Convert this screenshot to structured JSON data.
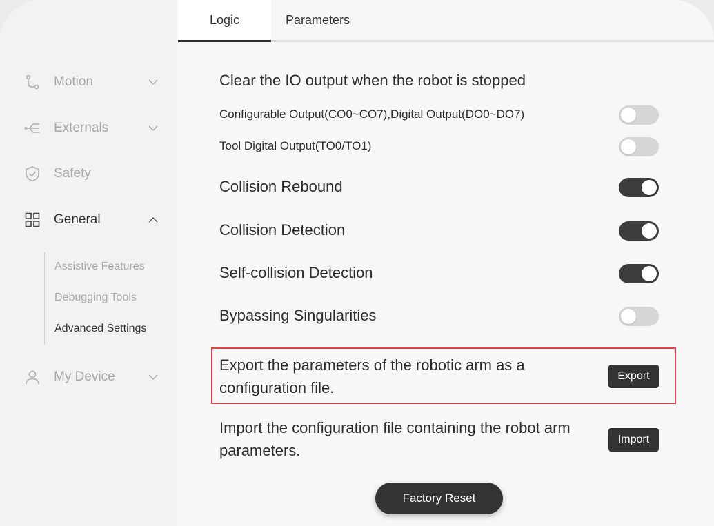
{
  "tabs": [
    {
      "label": "Logic",
      "active": true
    },
    {
      "label": "Parameters",
      "active": false
    }
  ],
  "sidebar": {
    "items": [
      {
        "label": "Motion",
        "icon": "route-icon",
        "expanded": false
      },
      {
        "label": "Externals",
        "icon": "branch-icon",
        "expanded": false
      },
      {
        "label": "Safety",
        "icon": "shield-check-icon"
      },
      {
        "label": "General",
        "icon": "grid-icon",
        "expanded": true
      },
      {
        "label": "My Device",
        "icon": "user-icon",
        "expanded": false
      }
    ],
    "general_subitems": [
      {
        "label": "Assistive Features",
        "current": false
      },
      {
        "label": "Debugging Tools",
        "current": false
      },
      {
        "label": "Advanced Settings",
        "current": true
      }
    ]
  },
  "settings": {
    "io_clear_heading": "Clear the IO output when the robot is stopped",
    "configurable_output": {
      "label": "Configurable Output(CO0~CO7),Digital Output(DO0~DO7)",
      "enabled": false
    },
    "tool_digital_output": {
      "label": "Tool Digital Output(TO0/TO1)",
      "enabled": false
    },
    "collision_rebound": {
      "label": "Collision Rebound",
      "enabled": true
    },
    "collision_detection": {
      "label": "Collision Detection",
      "enabled": true
    },
    "self_collision_detection": {
      "label": "Self-collision Detection",
      "enabled": true
    },
    "bypassing_singularities": {
      "label": "Bypassing Singularities",
      "enabled": false
    }
  },
  "export": {
    "text_line1": "Export the parameters of the robotic arm as a",
    "text_line2": "configuration file.",
    "button_label": "Export"
  },
  "import": {
    "text_line1": "Import the configuration file containing the robot arm",
    "text_line2": "parameters.",
    "button_label": "Import"
  },
  "factory_reset_label": "Factory Reset",
  "colors": {
    "accent_dark": "#333333",
    "highlight_border": "#e0454a",
    "toggle_off": "#d6d6d6"
  }
}
